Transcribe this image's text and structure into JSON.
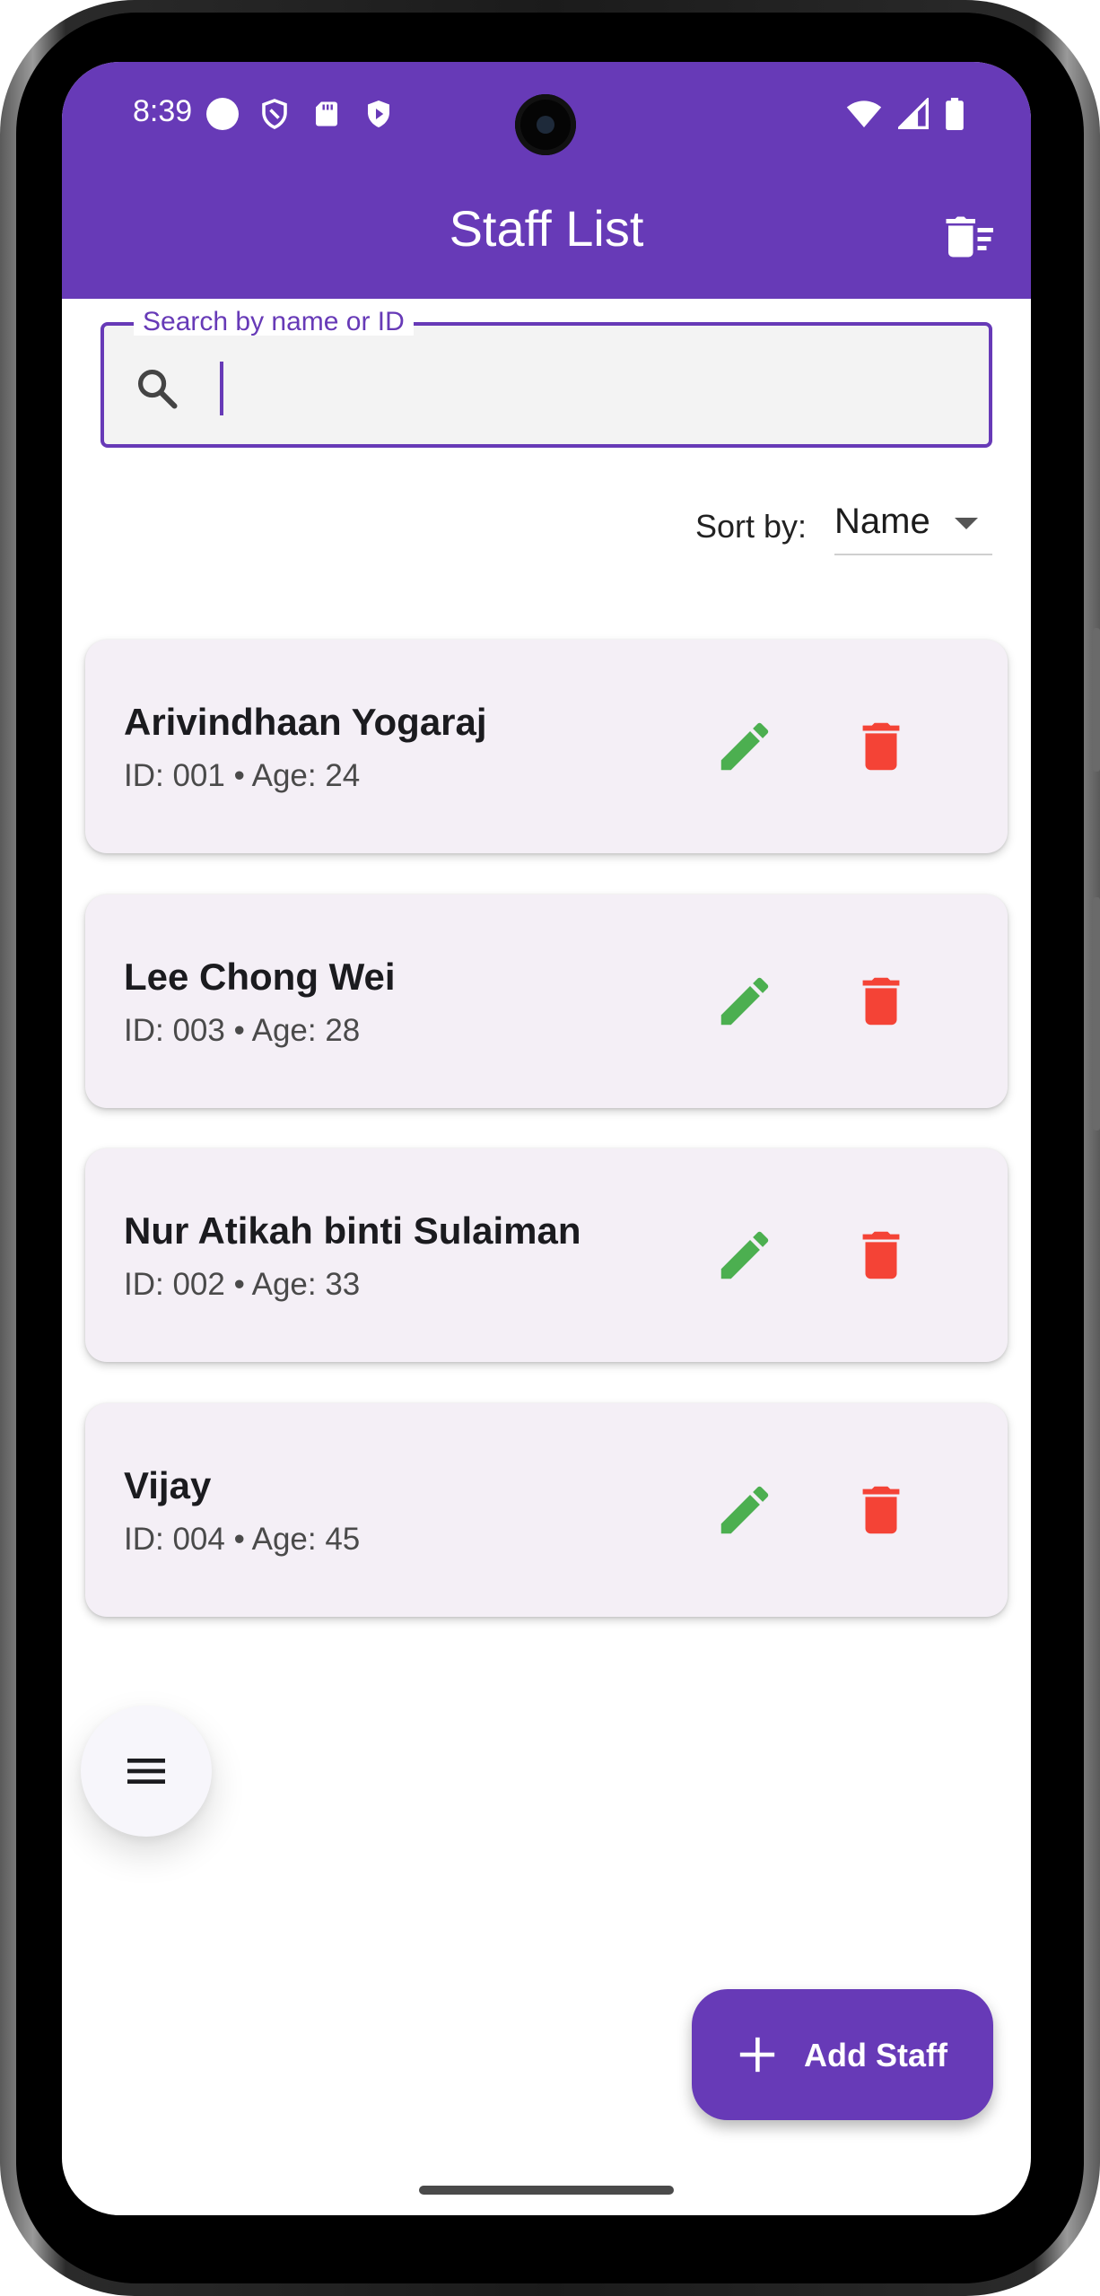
{
  "status_bar": {
    "time": "8:39"
  },
  "app_bar": {
    "title": "Staff List",
    "delete_all_icon": "delete-sweep-icon"
  },
  "search": {
    "label": "Search by name or ID",
    "value": ""
  },
  "sort": {
    "label": "Sort by:",
    "selected": "Name"
  },
  "staff": [
    {
      "name": "Arivindhaan Yogaraj",
      "meta": "ID: 001 • Age: 24"
    },
    {
      "name": "Lee Chong Wei",
      "meta": "ID: 003 • Age: 28"
    },
    {
      "name": "Nur Atikah binti Sulaiman",
      "meta": "ID: 002 • Age: 33"
    },
    {
      "name": "Vijay",
      "meta": "ID: 004 • Age: 45"
    }
  ],
  "fab": {
    "add_label": "Add Staff"
  },
  "colors": {
    "primary": "#673ab7",
    "edit": "#4caf50",
    "delete": "#f44336",
    "card_bg": "#f4eff6"
  }
}
